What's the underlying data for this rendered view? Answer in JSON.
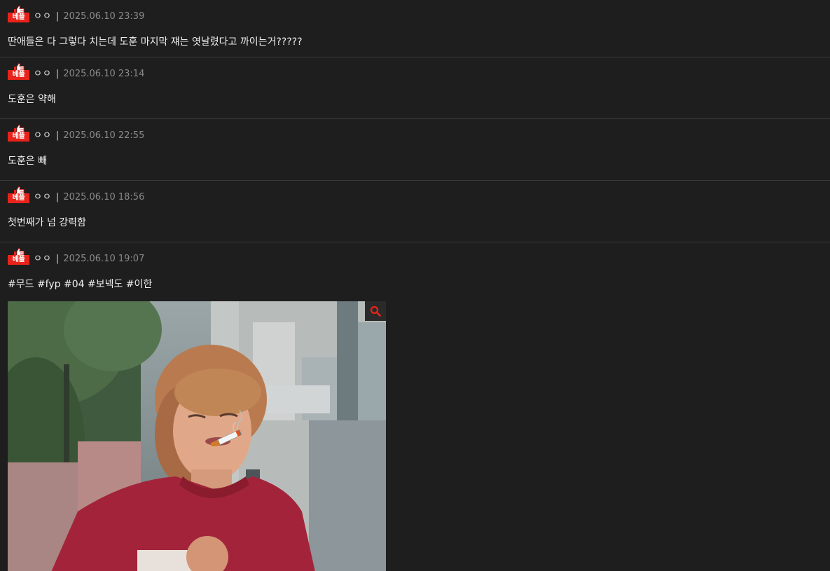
{
  "badge_label": "베플",
  "icons": {
    "badge": "thumbs-up-icon",
    "zoom": "search-icon",
    "sticker": "cigarette-icon"
  },
  "colors": {
    "background": "#1e1e1e",
    "badge": "#e8231b",
    "date": "#8a8a8a",
    "zoom_icon": "#e8231b"
  },
  "posts": [
    {
      "author": "ㅇㅇ",
      "separator": "|",
      "date": "2025.06.10 23:39",
      "text": "딴애들은 다 그렇다 치는데 도훈 마지막 쟤는 엿날렸다고 까이는거?????"
    },
    {
      "author": "ㅇㅇ",
      "separator": "|",
      "date": "2025.06.10 23:14",
      "text": "도훈은 약해"
    },
    {
      "author": "ㅇㅇ",
      "separator": "|",
      "date": "2025.06.10 22:55",
      "text": "도훈은 빼"
    },
    {
      "author": "ㅇㅇ",
      "separator": "|",
      "date": "2025.06.10 18:56",
      "text": "첫번째가 넘 강력함"
    },
    {
      "author": "ㅇㅇ",
      "separator": "|",
      "date": "2025.06.10 19:07",
      "text": "#무드 #fyp #04 #보넥도 #이한"
    }
  ]
}
